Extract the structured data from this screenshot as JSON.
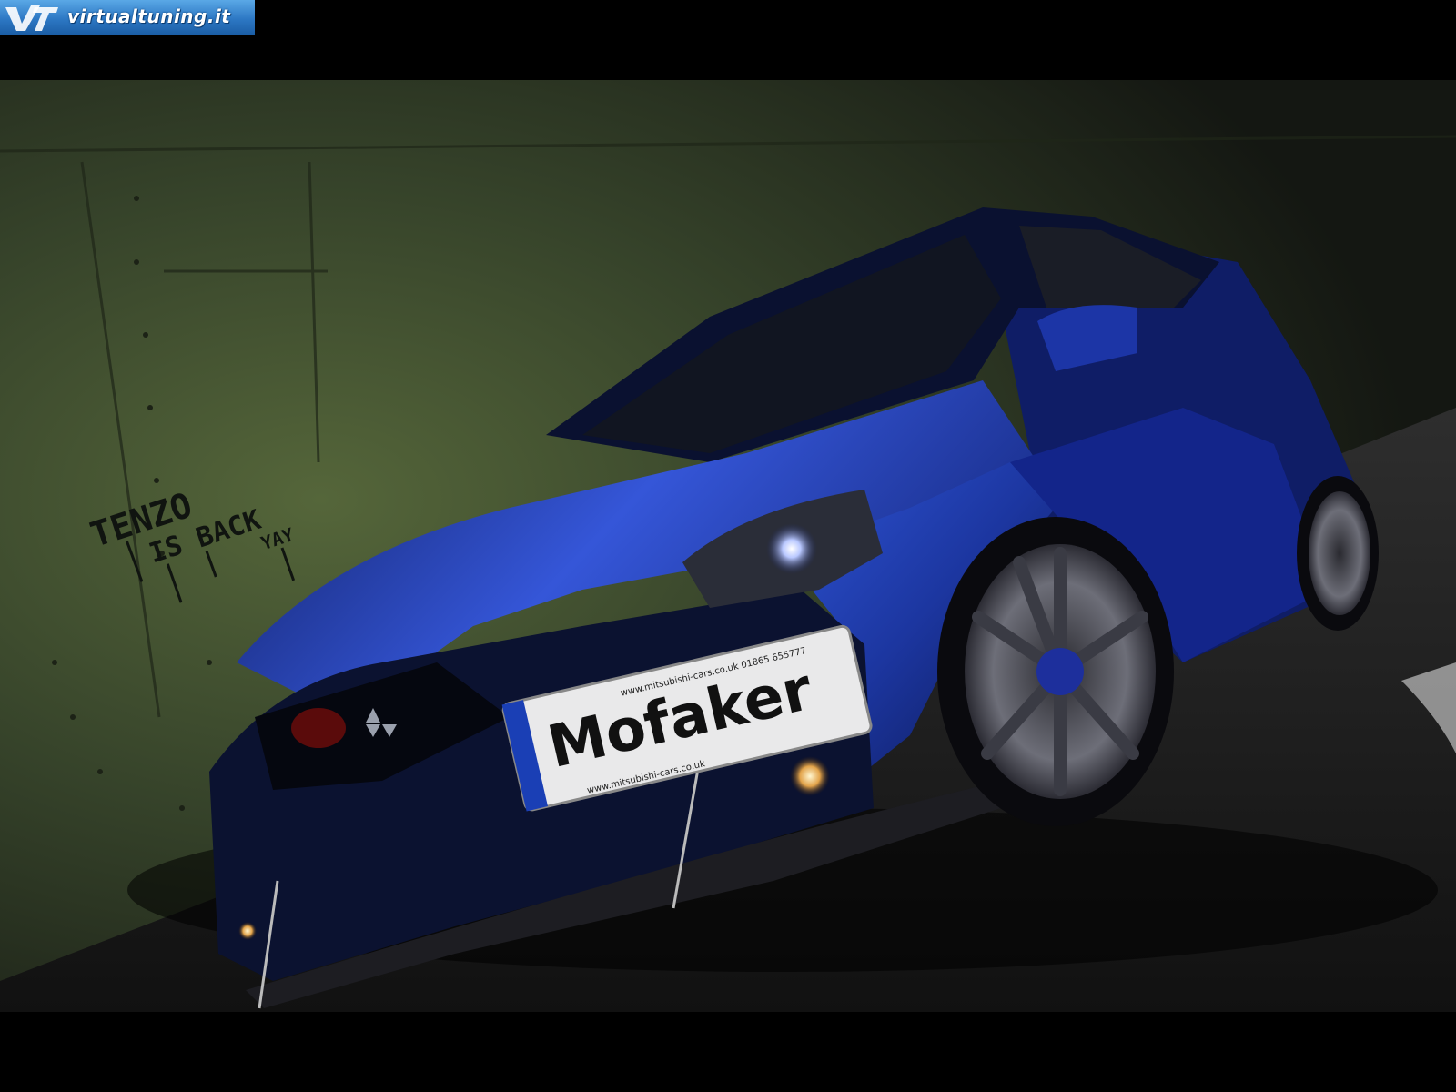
{
  "watermark": {
    "text": "virtualtuning.it",
    "icon": "vt-logo-icon"
  },
  "graffiti": {
    "line1": "TENZO",
    "line2": "IS BACK",
    "line3": "YAY"
  },
  "plate": {
    "main": "Mofaker",
    "top_small": "www.mitsubishi-cars.co.uk   01865 655777",
    "bottom_small": "www.mitsubishi-cars.co.uk"
  },
  "colors": {
    "car_blue": "#1f3fb0",
    "wall_green": "#3c4a2a",
    "floor_grey": "#2a2a2a"
  }
}
